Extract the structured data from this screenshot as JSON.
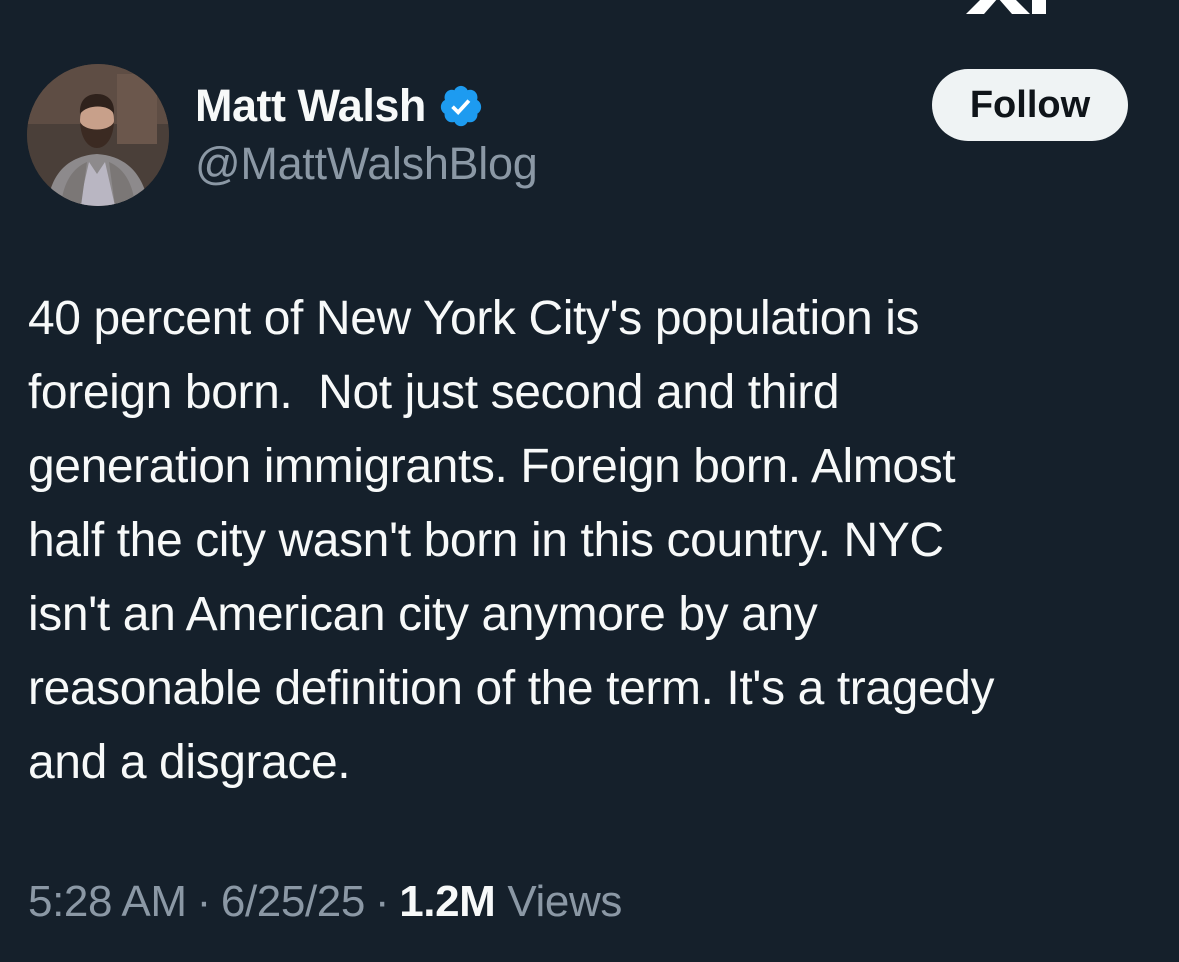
{
  "author": {
    "display_name": "Matt Walsh",
    "handle": "@MattWalshBlog",
    "verified_icon": "verified-badge-icon",
    "avatar_icon": "profile-photo-avatar"
  },
  "actions": {
    "follow_label": "Follow"
  },
  "tweet": {
    "lines": [
      "40 percent of New York City's population is",
      "foreign born.  Not just second and third",
      "generation immigrants. Foreign born. Almost",
      "half the city wasn't born in this country. NYC",
      "isn't an American city anymore by any",
      "reasonable definition of the term. It's a tragedy",
      "and a disgrace."
    ]
  },
  "meta": {
    "time": "5:28 AM",
    "separator": "·",
    "date": "6/25/25",
    "views_count": "1.2M",
    "views_label": "Views"
  },
  "colors": {
    "background": "#15202b",
    "primary_text": "#f7f9f9",
    "secondary_text": "#8b98a5",
    "verified_blue": "#1d9bf0",
    "follow_button_bg": "#eff3f4",
    "follow_button_text": "#0f1419"
  }
}
